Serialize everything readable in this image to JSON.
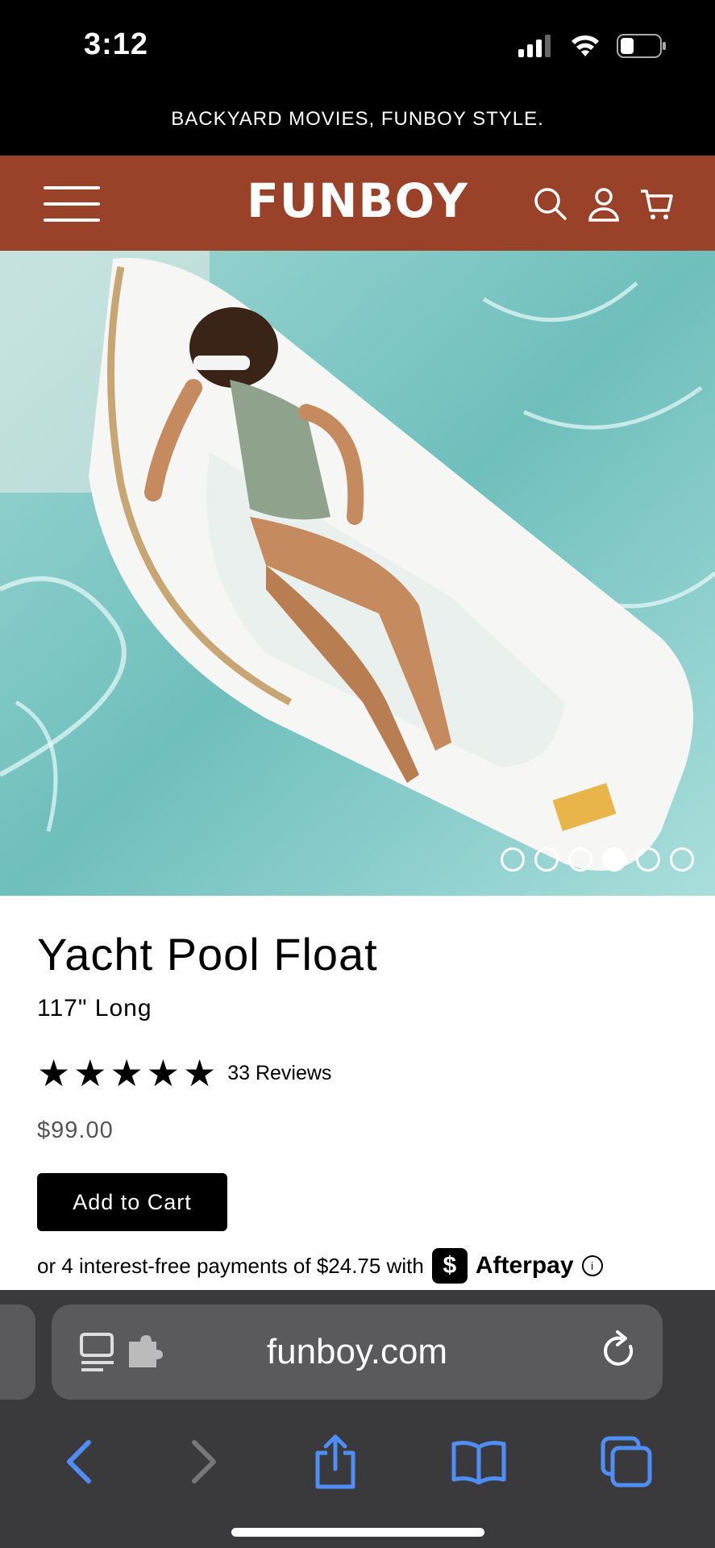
{
  "status": {
    "time": "3:12"
  },
  "promo": {
    "text": "BACKYARD MOVIES, FUNBOY STYLE."
  },
  "nav": {
    "logo": "FUNBOY"
  },
  "gallery": {
    "slides": 6,
    "active_index": 3
  },
  "product": {
    "title": "Yacht Pool Float",
    "subtitle": "117\" Long",
    "stars": "★★★★★",
    "reviews": "33 Reviews",
    "price": "$99.00",
    "cart_label": "Add to Cart",
    "afterpay_text": "or 4 interest-free payments of $24.75 with",
    "afterpay_badge": "$",
    "afterpay_brand": "Afterpay"
  },
  "browser": {
    "url": "funboy.com"
  },
  "colors": {
    "brand": "#9a4229",
    "browser_bg": "#3a3a3c",
    "icon_blue": "#4f8ef7"
  }
}
